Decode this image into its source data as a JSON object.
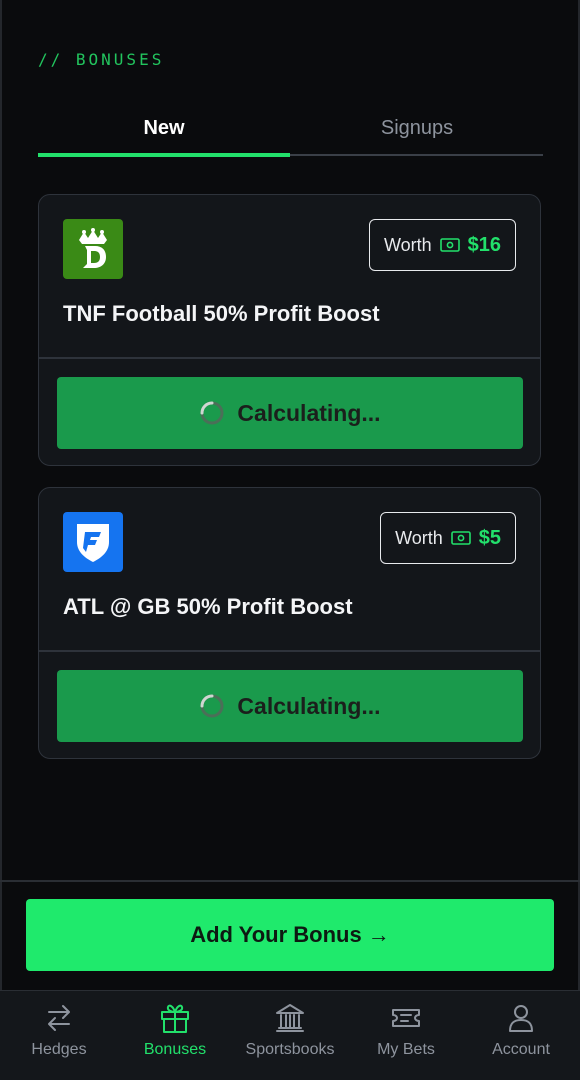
{
  "section_label": "// BONUSES",
  "tabs": [
    {
      "label": "New",
      "active": true
    },
    {
      "label": "Signups",
      "active": false
    }
  ],
  "bonuses": [
    {
      "book": "DraftKings",
      "logo_icon": "draftkings-crown-logo",
      "worth_label": "Worth",
      "worth_amount": "$16",
      "title": "TNF Football 50% Profit Boost",
      "button_label": "Calculating..."
    },
    {
      "book": "FanDuel",
      "logo_icon": "fanduel-shield-logo",
      "worth_label": "Worth",
      "worth_amount": "$5",
      "title": "ATL @ GB 50% Profit Boost",
      "button_label": "Calculating..."
    }
  ],
  "add_bonus_label": "Add Your Bonus →",
  "nav": [
    {
      "label": "Hedges",
      "icon": "arrows-swap-icon",
      "active": false
    },
    {
      "label": "Bonuses",
      "icon": "gift-icon",
      "active": true
    },
    {
      "label": "Sportsbooks",
      "icon": "bank-icon",
      "active": false
    },
    {
      "label": "My Bets",
      "icon": "ticket-icon",
      "active": false
    },
    {
      "label": "Account",
      "icon": "user-icon",
      "active": false
    }
  ],
  "colors": {
    "accent": "#22e06b",
    "card_button": "#1a9a4c",
    "cta": "#1fea6c",
    "background": "#0a0b0d",
    "draftkings_green": "#3a8a16",
    "fanduel_blue": "#1574f0"
  }
}
